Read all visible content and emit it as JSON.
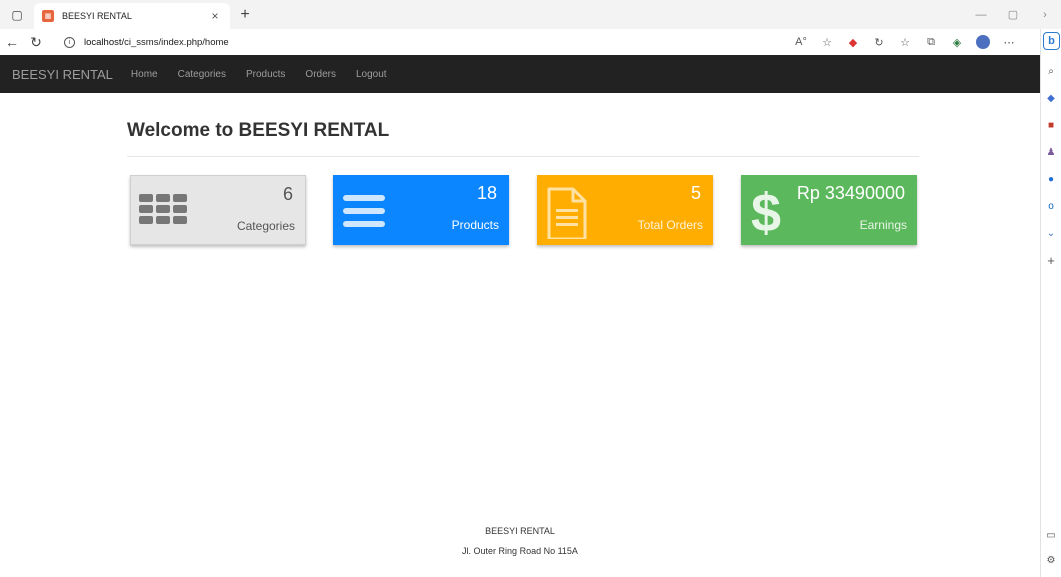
{
  "browser": {
    "tab_title": "BEESYI RENTAL",
    "tab_close": "×",
    "new_tab": "+",
    "url_prefix": "localhost/",
    "url_path": "ci_ssms/index.php/home",
    "icons": [
      "sidebar-toggle-icon",
      "close-icon",
      "plus-icon",
      "back-arrow-icon",
      "refresh-icon",
      "info-icon",
      "read-aloud-icon",
      "favorite-star-icon",
      "extension-icon",
      "favorites-icon",
      "collections-icon",
      "profile-avatar-icon",
      "more-icon",
      "bing-icon"
    ]
  },
  "navbar": {
    "brand": "BEESYI RENTAL",
    "items": [
      "Home",
      "Categories",
      "Products",
      "Orders",
      "Logout"
    ]
  },
  "main": {
    "title": "Welcome to BEESYI RENTAL",
    "cards": [
      {
        "value": "6",
        "label": "Categories",
        "icon": "grid-icon",
        "color": "#e6e6e6"
      },
      {
        "value": "18",
        "label": "Products",
        "icon": "list-icon",
        "color": "#0b86ff"
      },
      {
        "value": "5",
        "label": "Total Orders",
        "icon": "document-icon",
        "color": "#ffad00"
      },
      {
        "value": "Rp 33490000",
        "label": "Earnings",
        "icon": "dollar-icon",
        "color": "#5cb85c"
      }
    ]
  },
  "footer": {
    "name": "BEESYI RENTAL",
    "address": "Jl. Outer Ring Road No 115A"
  }
}
